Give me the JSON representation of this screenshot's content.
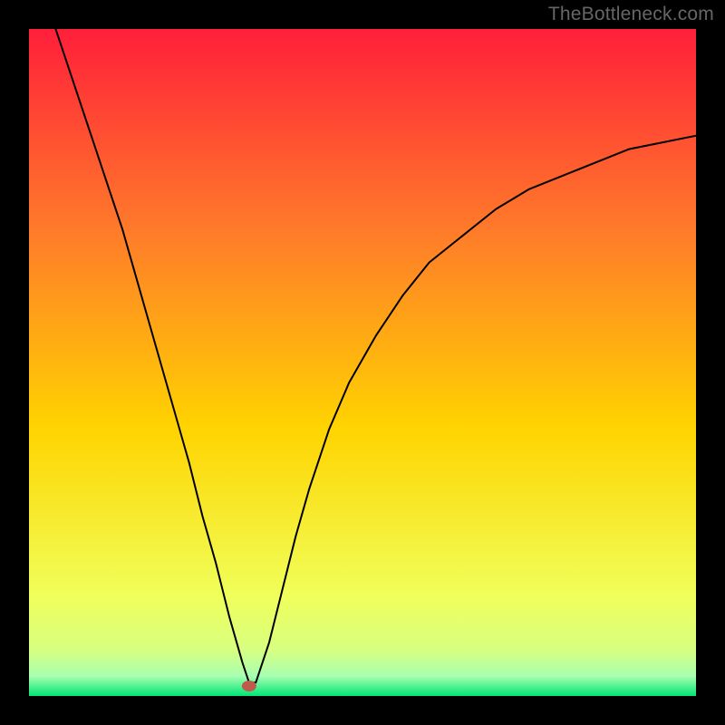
{
  "watermark": "TheBottleneck.com",
  "chart_data": {
    "type": "line",
    "title": "",
    "xlabel": "",
    "ylabel": "",
    "xlim": [
      0,
      100
    ],
    "ylim": [
      0,
      100
    ],
    "x": [
      4,
      6,
      8,
      10,
      12,
      14,
      16,
      18,
      20,
      22,
      24,
      26,
      28,
      30,
      32,
      33,
      34,
      36,
      38,
      40,
      42,
      45,
      48,
      52,
      56,
      60,
      65,
      70,
      75,
      80,
      85,
      90,
      95,
      100
    ],
    "y": [
      100,
      94,
      88,
      82,
      76,
      70,
      63,
      56,
      49,
      42,
      35,
      27,
      20,
      12,
      5,
      2,
      2,
      8,
      16,
      24,
      31,
      40,
      47,
      54,
      60,
      65,
      69,
      73,
      76,
      78,
      80,
      82,
      83,
      84
    ],
    "marker": {
      "x": 33,
      "y": 1.5
    },
    "gradient": {
      "top": "#ff1f3a",
      "mid_upper": "#ff7a2a",
      "mid": "#ffd400",
      "mid_lower": "#f0ff5a",
      "band1": "#d8ff80",
      "band2": "#a8ffb0",
      "bottom": "#00e676"
    }
  }
}
